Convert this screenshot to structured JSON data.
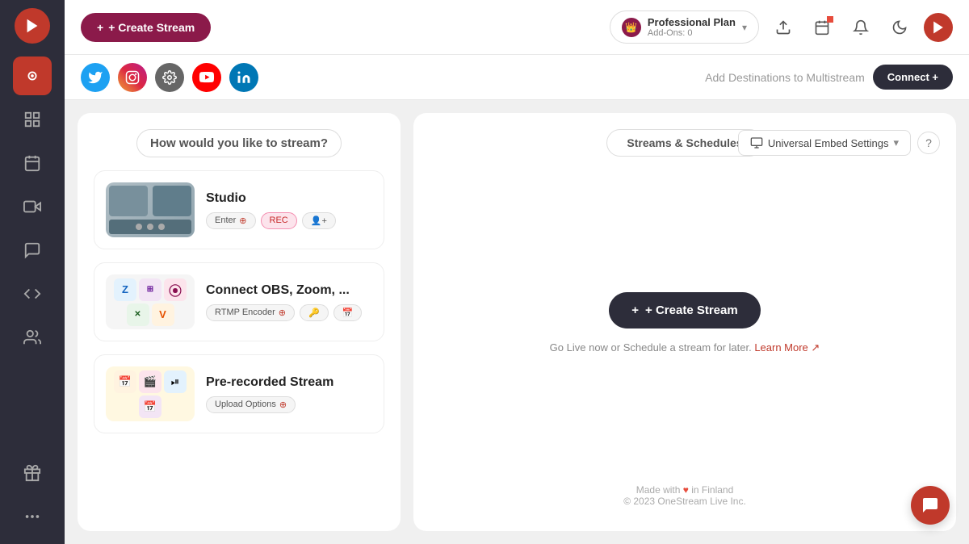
{
  "sidebar": {
    "logo_icon": "▶",
    "items": [
      {
        "id": "home",
        "icon": "⊙",
        "active": true
      },
      {
        "id": "grid",
        "icon": "⊞",
        "active": false
      },
      {
        "id": "calendar",
        "icon": "📅",
        "active": false
      },
      {
        "id": "video",
        "icon": "▶",
        "active": false
      },
      {
        "id": "chat",
        "icon": "💬",
        "active": false
      },
      {
        "id": "embed",
        "icon": "⊟",
        "active": false
      },
      {
        "id": "users",
        "icon": "👥",
        "active": false
      },
      {
        "id": "gift",
        "icon": "🎁",
        "active": false
      },
      {
        "id": "more",
        "icon": "•••",
        "active": false
      }
    ]
  },
  "topbar": {
    "create_stream_label": "+ Create Stream",
    "plan": {
      "name": "Professional Plan",
      "addons": "Add-Ons: 0"
    },
    "icons": [
      "upload",
      "calendar",
      "bell",
      "moon"
    ]
  },
  "destinations": {
    "label": "Add Destinations to Multistream",
    "connect_label": "Connect +"
  },
  "left_panel": {
    "title": "How would you like to stream?",
    "options": [
      {
        "id": "studio",
        "title": "Studio",
        "tags": [
          "Enter",
          "REC",
          "👤+"
        ]
      },
      {
        "id": "connect",
        "title": "Connect OBS, Zoom, ...",
        "tags": [
          "RTMP Encoder",
          "🔑",
          "📅"
        ]
      },
      {
        "id": "prerecorded",
        "title": "Pre-recorded Stream",
        "tags": [
          "Upload Options"
        ]
      }
    ]
  },
  "right_panel": {
    "tab_label": "Streams & Schedules",
    "embed_settings_label": "Universal Embed Settings",
    "create_stream_label": "+ Create Stream",
    "go_live_text": "Go Live now or Schedule a stream for later.",
    "learn_more_label": "Learn More"
  },
  "footer": {
    "made_with": "Made with",
    "heart": "♥",
    "location": "in Finland",
    "copyright": "© 2023 OneStream Live Inc."
  }
}
